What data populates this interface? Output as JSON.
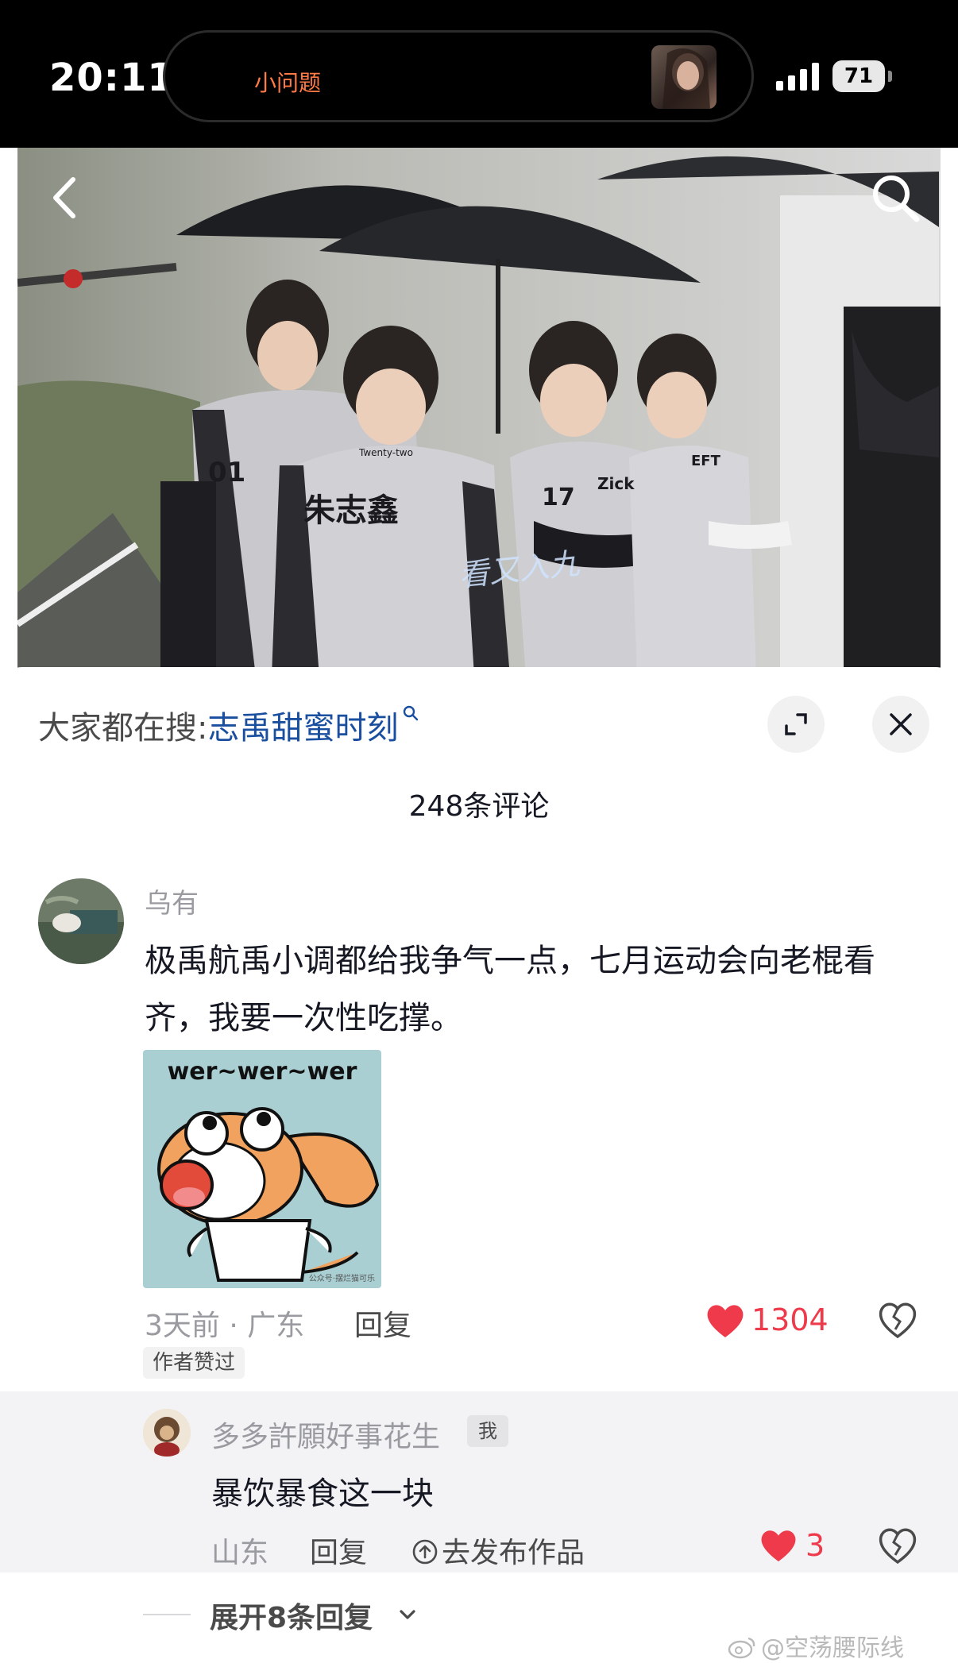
{
  "status_bar": {
    "time": "20:11",
    "island_text": "小问题",
    "battery": "71"
  },
  "video": {
    "overlay_text": "看又入九",
    "jersey_1": "01",
    "jersey_1_name": "朱志鑫",
    "jersey_1_label": "Twenty-two",
    "jersey_2": "17",
    "jersey_2_label": "Zick",
    "jersey_3_label": "EFT"
  },
  "search_suggestion": {
    "prefix": "大家都在搜:",
    "keyword": "志禹甜蜜时刻"
  },
  "comments_count": "248条评论",
  "comment": {
    "username": "乌有",
    "text": "极禹航禹小调都给我争气一点，七月运动会向老棍看齐，我要一次性吃撑。",
    "sticker_caption": "wer~wer~wer",
    "sticker_watermark": "公众号·摆烂猫可乐",
    "meta": "3天前 · 广东",
    "reply_label": "回复",
    "likes": "1304",
    "author_badge": "作者赞过"
  },
  "reply": {
    "username": "多多許願好事花生",
    "me_badge": "我",
    "text": "暴饮暴食这一块",
    "location": "山东",
    "reply_label": "回复",
    "publish_label": "去发布作品",
    "likes": "3"
  },
  "expand_replies": "展开8条回复",
  "watermark": "@空荡腰际线",
  "colors": {
    "accent_red": "#ee3a4a",
    "link_blue": "#1a4fa0",
    "island_orange": "#ff7a45"
  },
  "icons": [
    "back-arrow-icon",
    "search-icon",
    "expand-icon",
    "close-icon",
    "heart-icon",
    "broken-heart-icon",
    "publish-arrow-icon",
    "chevron-down-icon",
    "weibo-icon"
  ]
}
